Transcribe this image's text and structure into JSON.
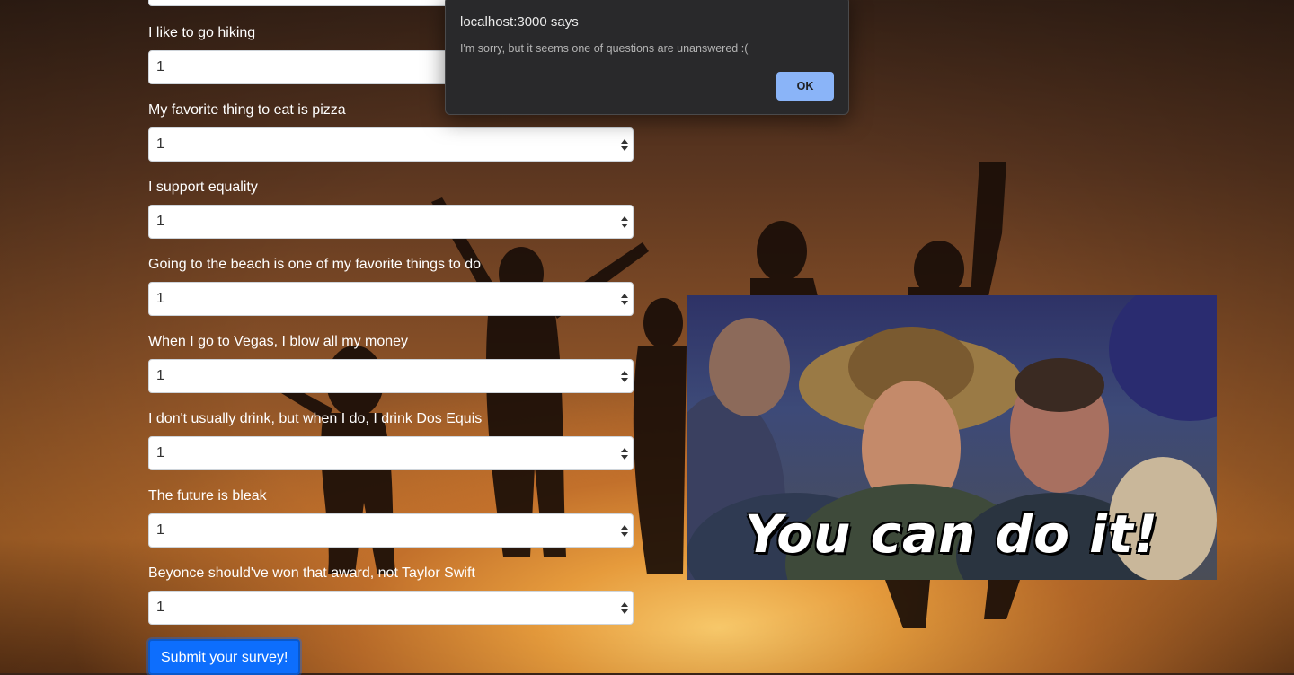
{
  "questions": [
    {
      "label": "",
      "value": ""
    },
    {
      "label": "I like to go hiking",
      "value": "1"
    },
    {
      "label": "My favorite thing to eat is pizza",
      "value": "1"
    },
    {
      "label": "I support equality",
      "value": "1"
    },
    {
      "label": "Going to the beach is one of my favorite things to do",
      "value": "1"
    },
    {
      "label": "When I go to Vegas, I blow all my money",
      "value": "1"
    },
    {
      "label": "I don't usually drink, but when I do, I drink Dos Equis",
      "value": "1"
    },
    {
      "label": "The future is bleak",
      "value": "1"
    },
    {
      "label": "Beyonce should've won that award, not Taylor Swift",
      "value": "1"
    }
  ],
  "submit_label": "Submit your survey!",
  "gif": {
    "caption": "You can do it!"
  },
  "dialog": {
    "title": "localhost:3000 says",
    "message": "I'm sorry, but it seems one of questions are unanswered :(",
    "ok_label": "OK"
  },
  "colors": {
    "submit": "#0d6efd",
    "dialog_bg": "#29292b",
    "dialog_ok": "#8ab4f8"
  }
}
